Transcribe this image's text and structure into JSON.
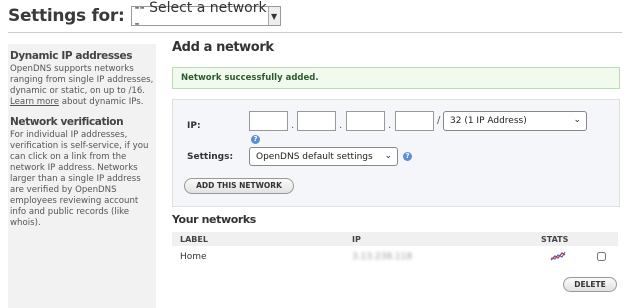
{
  "header": {
    "title": "Settings for:",
    "network_select_value": "-- Select a network --"
  },
  "sidebar": {
    "sections": [
      {
        "heading": "Dynamic IP addresses",
        "text_before_link": "OpenDNS supports networks ranging from single IP addresses, dynamic or static, on up to /16. ",
        "link": "Learn more",
        "text_after_link": " about dynamic IPs."
      },
      {
        "heading": "Network verification",
        "text": "For individual IP addresses, verification is self-service, if you can click on a link from the network IP address. Networks larger than a single IP address are verified by OpenDNS employees reviewing account info and public records (like whois)."
      }
    ]
  },
  "add_network": {
    "heading": "Add a network",
    "success_message": "Network successfully added.",
    "ip_label": "IP:",
    "ip_octets": [
      "",
      "",
      "",
      ""
    ],
    "separator_dot": ".",
    "separator_slash": "/",
    "prefix_select_value": "32 (1 IP Address)",
    "settings_label": "Settings:",
    "settings_select_value": "OpenDNS default settings",
    "help_glyph": "?",
    "add_button_label": "ADD THIS NETWORK"
  },
  "your_networks": {
    "heading": "Your networks",
    "columns": {
      "label": "LABEL",
      "ip": "IP",
      "stats": "STATS"
    },
    "rows": [
      {
        "label": "Home",
        "ip": "3.13.238.118",
        "stats_icon": "stats-graph-icon",
        "checked": false
      }
    ],
    "delete_button_label": "DELETE"
  },
  "colors": {
    "success_bg": "#f0fbee",
    "success_border": "#b9dbb7",
    "form_bg": "#f4f6f9",
    "sidebar_bg": "#f2f2f2",
    "help_icon": "#5b8fd1"
  }
}
